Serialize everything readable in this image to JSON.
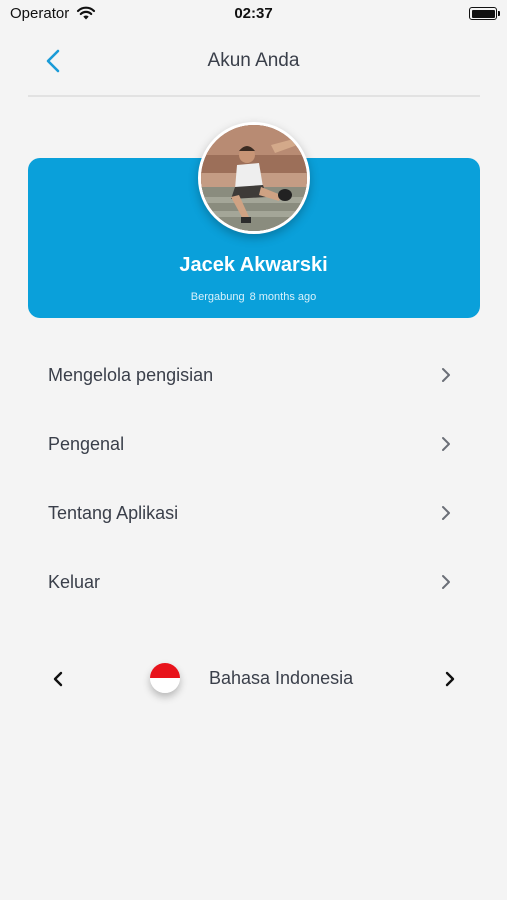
{
  "status_bar": {
    "carrier": "Operator",
    "time": "02:37",
    "icons": [
      "wifi-icon",
      "battery-icon"
    ]
  },
  "header": {
    "title": "Akun Anda",
    "back_icon": "chevron-left-icon",
    "accent_color": "#1a9bd7"
  },
  "profile": {
    "name": "Jacek Akwarski",
    "joined_label": "Bergabung",
    "joined_value": "8 months ago",
    "card_color": "#0aa0da"
  },
  "menu": [
    {
      "label": "Mengelola pengisian",
      "icon": "chevron-right-icon"
    },
    {
      "label": "Pengenal",
      "icon": "chevron-right-icon"
    },
    {
      "label": "Tentang Aplikasi",
      "icon": "chevron-right-icon"
    },
    {
      "label": "Keluar",
      "icon": "chevron-right-icon"
    }
  ],
  "language": {
    "label": "Bahasa Indonesia",
    "flag": "indonesia-flag-icon",
    "flag_colors": [
      "#e8131b",
      "#ffffff"
    ]
  }
}
